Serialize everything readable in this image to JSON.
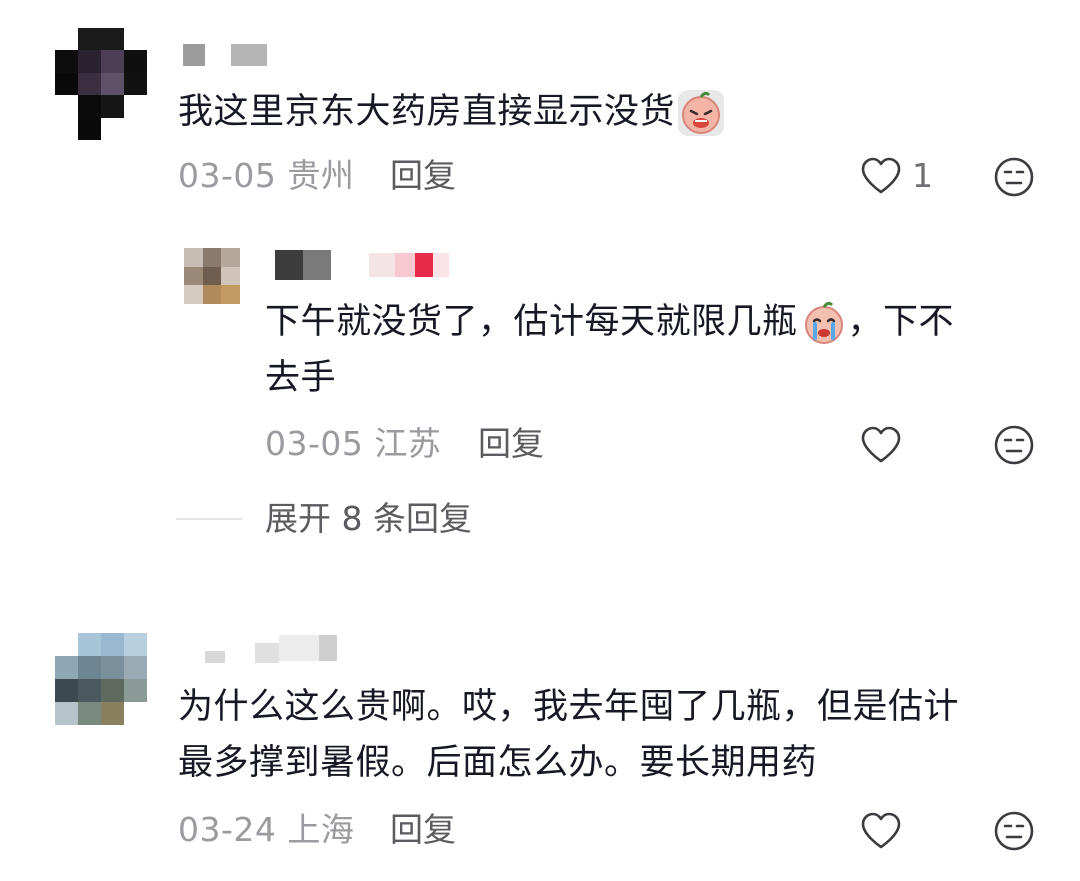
{
  "comments": [
    {
      "text": "我这里京东大药房直接显示没货",
      "emoji": "crying-face-emoji",
      "date": "03-05",
      "location": "贵州",
      "reply_label": "回复",
      "likes": "1",
      "replies": [
        {
          "text_line1": "下午就没货了，估计每天就限几瓶",
          "text_line1_tail": "，下不",
          "text_line2": "去手",
          "emoji": "sobbing-face-emoji",
          "date": "03-05",
          "location": "江苏",
          "reply_label": "回复"
        }
      ],
      "expand_label": "展开 8 条回复"
    },
    {
      "text_line1": "为什么这么贵啊。哎，我去年囤了几瓶，但是估计",
      "text_line2": "最多撑到暑假。后面怎么办。要长期用药",
      "date": "03-24",
      "location": "上海",
      "reply_label": "回复"
    }
  ],
  "colors": {
    "text": "#161823",
    "meta": "#9a9a9f",
    "reply": "#5b5b60",
    "icon": "#3c3c40"
  },
  "icons": [
    "heart-outline-icon",
    "neutral-face-icon"
  ]
}
